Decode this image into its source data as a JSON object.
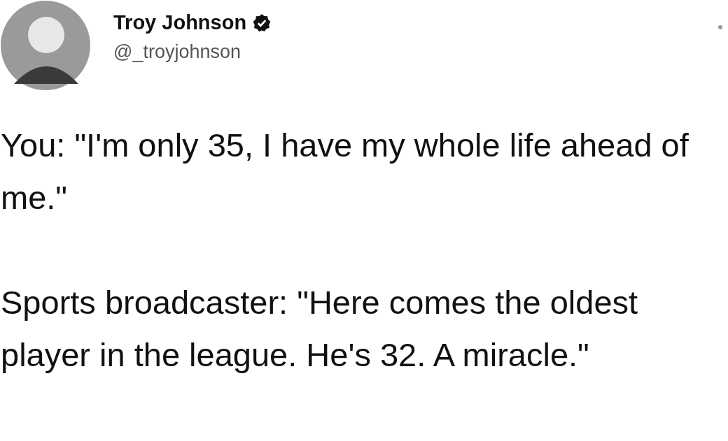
{
  "author": {
    "name": "Troy Johnson",
    "verified": true,
    "handle": "@_troyjohnson"
  },
  "paragraphs": [
    "You: \"I'm only 35, I have my whole life ahead of me.\"",
    "Sports broadcaster: \"Here comes the oldest player in the league. He's 32. A miracle.\""
  ]
}
